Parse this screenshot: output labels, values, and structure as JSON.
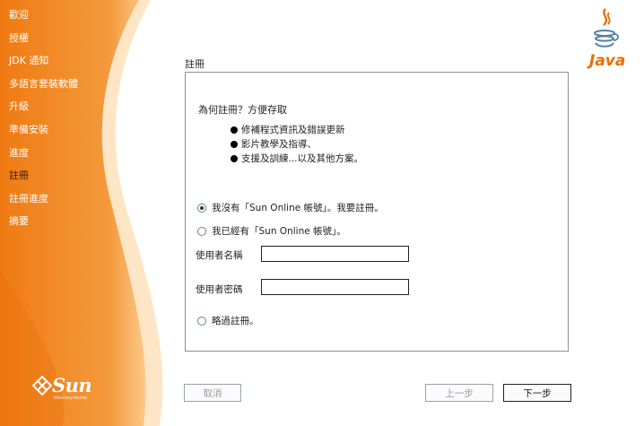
{
  "sidebar": {
    "items": [
      {
        "label": "歡迎"
      },
      {
        "label": "授權"
      },
      {
        "label": "JDK 通知"
      },
      {
        "label": "多語言套裝軟體"
      },
      {
        "label": "升級"
      },
      {
        "label": "準備安裝"
      },
      {
        "label": "進度"
      },
      {
        "label": "註冊"
      },
      {
        "label": "註冊進度"
      },
      {
        "label": "摘要"
      }
    ],
    "current_index": 7,
    "brand": {
      "name": "Sun",
      "tagline": "microsystems"
    },
    "colors": {
      "accent": "#f08a1e",
      "accent_light": "#fbc37a"
    }
  },
  "header": {
    "java_logo_text": "Java"
  },
  "page": {
    "title": "註冊"
  },
  "panel": {
    "question": "為何註冊？方便存取",
    "bullets": [
      "修補程式資訊及錯誤更新",
      "影片教學及指導、",
      "支援及訓練...以及其他方案。"
    ],
    "options": {
      "register_new": {
        "label": "我沒有「Sun Online 帳號」。我要註冊。",
        "selected": true
      },
      "have_account": {
        "label": "我已經有「Sun Online 帳號」。",
        "selected": false
      },
      "skip": {
        "label": "略過註冊。",
        "selected": false
      }
    },
    "fields": {
      "username": {
        "label": "使用者名稱",
        "value": ""
      },
      "password": {
        "label": "使用者密碼",
        "value": ""
      }
    }
  },
  "buttons": {
    "cancel": "取消",
    "back": "上一步",
    "next": "下一步"
  }
}
